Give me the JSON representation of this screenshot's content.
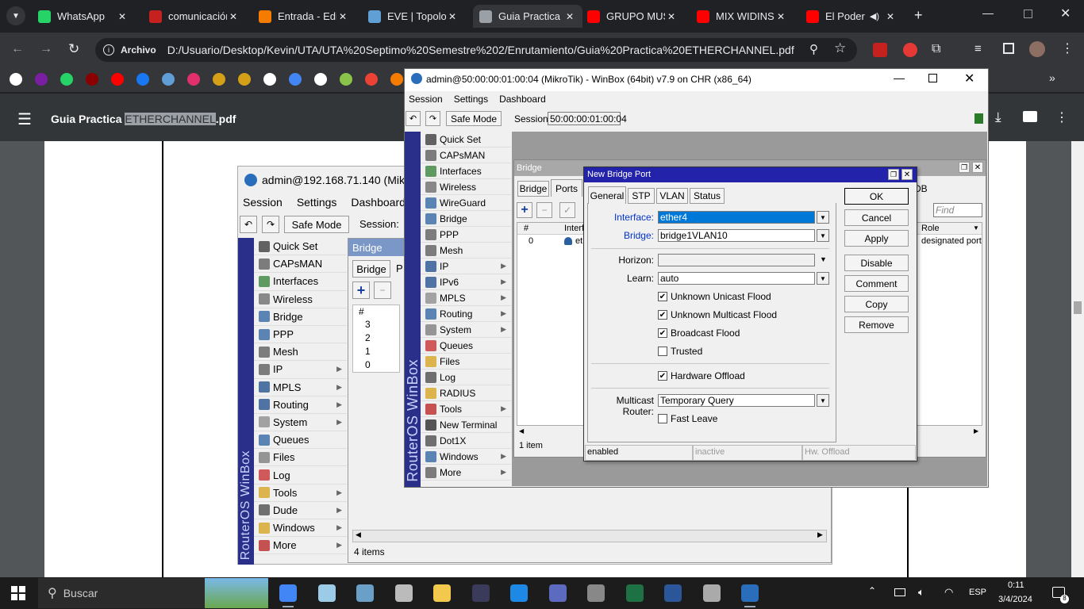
{
  "browser": {
    "tabs": [
      {
        "title": "WhatsApp",
        "icon": "whatsapp-icon",
        "color": "#25d366"
      },
      {
        "title": "comunicación",
        "icon": "location-icon",
        "color": "#c5221f"
      },
      {
        "title": "Entrada - Edi",
        "icon": "blogger-icon",
        "color": "#f57c00"
      },
      {
        "title": "EVE | Topolo",
        "icon": "eve-icon",
        "color": "#5f9fd6"
      },
      {
        "title": "Guia Practica",
        "icon": "globe-icon",
        "color": "#9aa0a6"
      },
      {
        "title": "GRUPO MUS",
        "icon": "youtube-icon",
        "color": "#ff0000"
      },
      {
        "title": "MIX WIDINS",
        "icon": "youtube-icon",
        "color": "#ff0000"
      },
      {
        "title": "El Poder",
        "icon": "youtube-icon",
        "color": "#ff0000"
      }
    ],
    "address_label": "Archivo",
    "url": "D:/Usuario/Desktop/Kevin/UTA/UTA%20Septimo%20Semestre%202/Enrutamiento/Guia%20Practica%20ETHERCHANNEL.pdf"
  },
  "pdf": {
    "title_prefix": "Guia Practica ",
    "title_highlight": "ETHERCHANNEL",
    "title_suffix": ".pdf"
  },
  "bg_winbox": {
    "title": "admin@192.168.71.140 (Mikr",
    "menu": [
      "Session",
      "Settings",
      "Dashboard"
    ],
    "safe_mode": "Safe Mode",
    "session_label": "Session:",
    "brand": "RouterOS WinBox",
    "items": [
      {
        "label": "Quick Set",
        "arrow": false
      },
      {
        "label": "CAPsMAN",
        "arrow": false
      },
      {
        "label": "Interfaces",
        "arrow": false
      },
      {
        "label": "Wireless",
        "arrow": false
      },
      {
        "label": "Bridge",
        "arrow": false
      },
      {
        "label": "PPP",
        "arrow": false
      },
      {
        "label": "Mesh",
        "arrow": false
      },
      {
        "label": "IP",
        "arrow": true
      },
      {
        "label": "MPLS",
        "arrow": true
      },
      {
        "label": "Routing",
        "arrow": true
      },
      {
        "label": "System",
        "arrow": true
      },
      {
        "label": "Queues",
        "arrow": false
      },
      {
        "label": "Files",
        "arrow": false
      },
      {
        "label": "Log",
        "arrow": false
      },
      {
        "label": "Tools",
        "arrow": true
      },
      {
        "label": "Dude",
        "arrow": true
      },
      {
        "label": "Windows",
        "arrow": true
      },
      {
        "label": "More",
        "arrow": true
      }
    ],
    "bridge_title": "Bridge",
    "bridge_tabs": [
      "Bridge",
      "P"
    ],
    "col_hash": "#",
    "rows": [
      "3",
      "2",
      "1",
      "0"
    ],
    "count": "4 items"
  },
  "winbox": {
    "title": "admin@50:00:00:01:00:04 (MikroTik) - WinBox (64bit) v7.9 on CHR (x86_64)",
    "menu": [
      "Session",
      "Settings",
      "Dashboard"
    ],
    "safe_mode": "Safe Mode",
    "session_label": "Session:",
    "session_value": "50:00:00:01:00:04",
    "brand": "RouterOS WinBox",
    "items": [
      {
        "label": "Quick Set",
        "arrow": false
      },
      {
        "label": "CAPsMAN",
        "arrow": false
      },
      {
        "label": "Interfaces",
        "arrow": false
      },
      {
        "label": "Wireless",
        "arrow": false
      },
      {
        "label": "WireGuard",
        "arrow": false
      },
      {
        "label": "Bridge",
        "arrow": false
      },
      {
        "label": "PPP",
        "arrow": false
      },
      {
        "label": "Mesh",
        "arrow": false
      },
      {
        "label": "IP",
        "arrow": true
      },
      {
        "label": "IPv6",
        "arrow": true
      },
      {
        "label": "MPLS",
        "arrow": true
      },
      {
        "label": "Routing",
        "arrow": true
      },
      {
        "label": "System",
        "arrow": true
      },
      {
        "label": "Queues",
        "arrow": false
      },
      {
        "label": "Files",
        "arrow": false
      },
      {
        "label": "Log",
        "arrow": false
      },
      {
        "label": "RADIUS",
        "arrow": false
      },
      {
        "label": "Tools",
        "arrow": true
      },
      {
        "label": "New Terminal",
        "arrow": false
      },
      {
        "label": "Dot1X",
        "arrow": false
      },
      {
        "label": "Windows",
        "arrow": true
      },
      {
        "label": "More",
        "arrow": true
      }
    ],
    "bridge": {
      "title": "Bridge",
      "tabs": [
        "Bridge",
        "Ports"
      ],
      "tab_right": "DB",
      "find_placeholder": "Find",
      "col_hash": "#",
      "col_interface": "Interf",
      "col_role": "Role",
      "row_num": "0",
      "row_iface": "et",
      "row_role": "designated port",
      "count": "1 item"
    }
  },
  "dialog": {
    "title": "New Bridge Port",
    "tabs": [
      "General",
      "STP",
      "VLAN",
      "Status"
    ],
    "interface_label": "Interface:",
    "interface_value": "ether4",
    "bridge_label": "Bridge:",
    "bridge_value": "bridge1VLAN10",
    "horizon_label": "Horizon:",
    "horizon_value": "",
    "learn_label": "Learn:",
    "learn_value": "auto",
    "checks": [
      {
        "label": "Unknown Unicast Flood",
        "checked": true
      },
      {
        "label": "Unknown Multicast Flood",
        "checked": true
      },
      {
        "label": "Broadcast Flood",
        "checked": true
      },
      {
        "label": "Trusted",
        "checked": false
      }
    ],
    "hw_offload": {
      "label": "Hardware Offload",
      "checked": true
    },
    "multicast_label": "Multicast Router:",
    "multicast_value": "Temporary Query",
    "fast_leave": {
      "label": "Fast Leave",
      "checked": false
    },
    "buttons": [
      "OK",
      "Cancel",
      "Apply",
      "Disable",
      "Comment",
      "Copy",
      "Remove"
    ],
    "status": [
      "enabled",
      "inactive",
      "Hw. Offload"
    ]
  },
  "taskbar": {
    "search": "Buscar",
    "lang": "ESP",
    "time": "0:11",
    "date": "3/4/2024",
    "notif": "8"
  }
}
